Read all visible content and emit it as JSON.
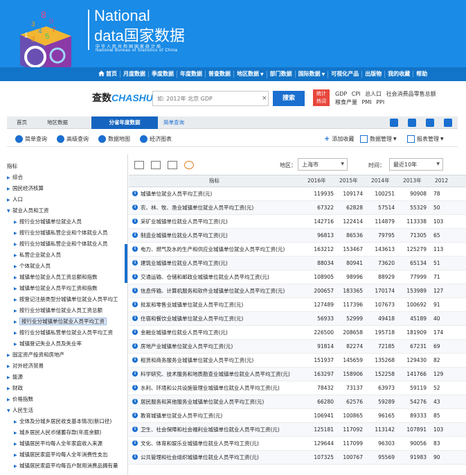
{
  "brand": {
    "en_line1": "National",
    "en_line2_prefix": "data",
    "en_line2_cn": "国家数据",
    "cn_sub": "中华人民共和国国家统计局",
    "en_sub": "National Bureau of Statistics of China"
  },
  "nav": [
    "首页",
    "月度数据",
    "季度数据",
    "年度数据",
    "普查数据",
    "地区数据",
    "部门数据",
    "国际数据",
    "可视化产品",
    "出版物",
    "我的收藏",
    "帮助"
  ],
  "search": {
    "logo_part1": "查数",
    "logo_part2": "CHASHU",
    "placeholder": "如: 2012年 北京 GDP",
    "clear": "×",
    "button": "搜索",
    "badge_line1": "统计",
    "badge_line2": "热词",
    "hot_words": [
      "GDP",
      "CPI",
      "总人口",
      "社会消费品零售总额",
      "粮食产量",
      "PMI",
      "PPI"
    ]
  },
  "breadcrumb": {
    "home": "首页",
    "region": "地区数据",
    "active": "分省年度数据",
    "link": "简单查询"
  },
  "toolbar": {
    "simple": "简单查询",
    "advanced": "高级查询",
    "map": "数据地图",
    "charts": "经济图表",
    "favorite": "添加收藏",
    "data_mgmt": "数据管理",
    "report_mgmt": "报表管理"
  },
  "sidebar": {
    "items": [
      {
        "label": "指标",
        "level": 0
      },
      {
        "label": "综合",
        "level": 1
      },
      {
        "label": "国民经济核算",
        "level": 1
      },
      {
        "label": "人口",
        "level": 1
      },
      {
        "label": "就业人员和工资",
        "level": 1,
        "open": true
      },
      {
        "label": "按行业分城镇单位就业人员",
        "level": 2
      },
      {
        "label": "按行业分城镇私营企业和个体就业人员",
        "level": 2
      },
      {
        "label": "按行业分城镇私营企业和个体就业人员",
        "level": 2
      },
      {
        "label": "私营企业就业人员",
        "level": 2
      },
      {
        "label": "个体就业人员",
        "level": 2
      },
      {
        "label": "城镇单位就业人员工资总额和指数",
        "level": 2
      },
      {
        "label": "城镇单位就业人员平均工资和指数",
        "level": 2
      },
      {
        "label": "按登记注册类型分城镇单位就业人员平均工",
        "level": 2
      },
      {
        "label": "按行业分城镇单位就业人员工资总额",
        "level": 2
      },
      {
        "label": "按行业分城镇单位就业人员平均工资",
        "level": 2,
        "selected": true
      },
      {
        "label": "按行业分城镇私营单位就业人员平均工资",
        "level": 2
      },
      {
        "label": "城镇登记失业人员及失业率",
        "level": 2
      },
      {
        "label": "固定资产投资和房地产",
        "level": 1
      },
      {
        "label": "对外经济贸易",
        "level": 1
      },
      {
        "label": "能源",
        "level": 1
      },
      {
        "label": "财政",
        "level": 1
      },
      {
        "label": "价格指数",
        "level": 1
      },
      {
        "label": "人民生活",
        "level": 1,
        "open": true
      },
      {
        "label": "全体及分城乡居民收支基本情况(新口径)",
        "level": 2
      },
      {
        "label": "城乡居民人民币储蓄存款(年底余额)",
        "level": 2
      },
      {
        "label": "城镇居民平均每人全年家庭收入来源",
        "level": 2
      },
      {
        "label": "城镇居民家庭平均每人全年消费性支出",
        "level": 2
      },
      {
        "label": "城镇居民家庭平均每百户耐用消费品拥有量",
        "level": 2
      }
    ]
  },
  "filters": {
    "region_label": "地区：",
    "region_value": "上海市",
    "time_label": "时间：",
    "time_value": "最近10年"
  },
  "table": {
    "header": {
      "indicator": "指标",
      "years": [
        "2016年",
        "2015年",
        "2014年",
        "2013年",
        "2012"
      ]
    },
    "rows": [
      {
        "name": "城镇单位就业人员平均工资(元)",
        "values": [
          "119935",
          "109174",
          "100251",
          "90908",
          "78"
        ]
      },
      {
        "name": "农、林、牧、渔业城镇单位就业人员平均工资(元)",
        "values": [
          "67322",
          "62828",
          "57514",
          "55329",
          "50"
        ]
      },
      {
        "name": "采矿业城镇单位就业人员平均工资(元)",
        "values": [
          "142716",
          "122414",
          "114879",
          "113338",
          "103"
        ]
      },
      {
        "name": "制造业城镇单位就业人员平均工资(元)",
        "values": [
          "96813",
          "86536",
          "79795",
          "71305",
          "65"
        ]
      },
      {
        "name": "电力、燃气及水的生产和供应业城镇单位就业人员平均工资(元)",
        "values": [
          "163212",
          "153467",
          "143613",
          "125279",
          "113"
        ]
      },
      {
        "name": "建筑业城镇单位就业人员平均工资(元)",
        "values": [
          "88034",
          "80941",
          "73620",
          "65134",
          "51"
        ]
      },
      {
        "name": "交通运输、仓储和邮政业城镇单位就业人员平均工资(元)",
        "values": [
          "108905",
          "98996",
          "88929",
          "77999",
          "71"
        ]
      },
      {
        "name": "信息传输、计算机服务和软件业城镇单位就业人员平均工资(元)",
        "values": [
          "200657",
          "183365",
          "170174",
          "153989",
          "127"
        ]
      },
      {
        "name": "批发和零售业城镇单位就业人员平均工资(元)",
        "values": [
          "127489",
          "117396",
          "107673",
          "100692",
          "91"
        ]
      },
      {
        "name": "住宿和餐饮业城镇单位就业人员平均工资(元)",
        "values": [
          "56933",
          "52999",
          "49418",
          "45189",
          "40"
        ]
      },
      {
        "name": "金融业城镇单位就业人员平均工资(元)",
        "values": [
          "226500",
          "208658",
          "195718",
          "181909",
          "174"
        ]
      },
      {
        "name": "房地产业城镇单位就业人员平均工资(元)",
        "values": [
          "91814",
          "82274",
          "72185",
          "67231",
          "69"
        ]
      },
      {
        "name": "租赁和商务服务业城镇单位就业人员平均工资(元)",
        "values": [
          "151937",
          "145659",
          "135268",
          "129430",
          "82"
        ]
      },
      {
        "name": "科学研究、技术服务和地质勘查业城镇单位就业人员平均工资(元)",
        "values": [
          "163297",
          "158906",
          "152258",
          "141766",
          "129"
        ]
      },
      {
        "name": "水利、环境和公共设施管理业城镇单位就业人员平均工资(元)",
        "values": [
          "78432",
          "73137",
          "63973",
          "59119",
          "52"
        ]
      },
      {
        "name": "居民服务和其他服务业城镇单位就业人员平均工资(元)",
        "values": [
          "66280",
          "62576",
          "59289",
          "54276",
          "43"
        ]
      },
      {
        "name": "教育城镇单位就业人员平均工资(元)",
        "values": [
          "106941",
          "100865",
          "96165",
          "89333",
          "85"
        ]
      },
      {
        "name": "卫生、社会保障和社会福利业城镇单位就业人员平均工资(元)",
        "values": [
          "125181",
          "117092",
          "113142",
          "107891",
          "103"
        ]
      },
      {
        "name": "文化、体育和娱乐业城镇单位就业人员平均工资(元)",
        "values": [
          "129644",
          "117099",
          "96303",
          "90056",
          "83"
        ]
      },
      {
        "name": "公共管理和社会组织城镇单位就业人员平均工资(元)",
        "values": [
          "107325",
          "100767",
          "95569",
          "91983",
          "90"
        ]
      }
    ]
  },
  "colors": {
    "brand_blue": "#1a8be6",
    "nav_blue": "#1274c8",
    "accent": "#1a6fd0",
    "badge_red": "#e8473c"
  }
}
